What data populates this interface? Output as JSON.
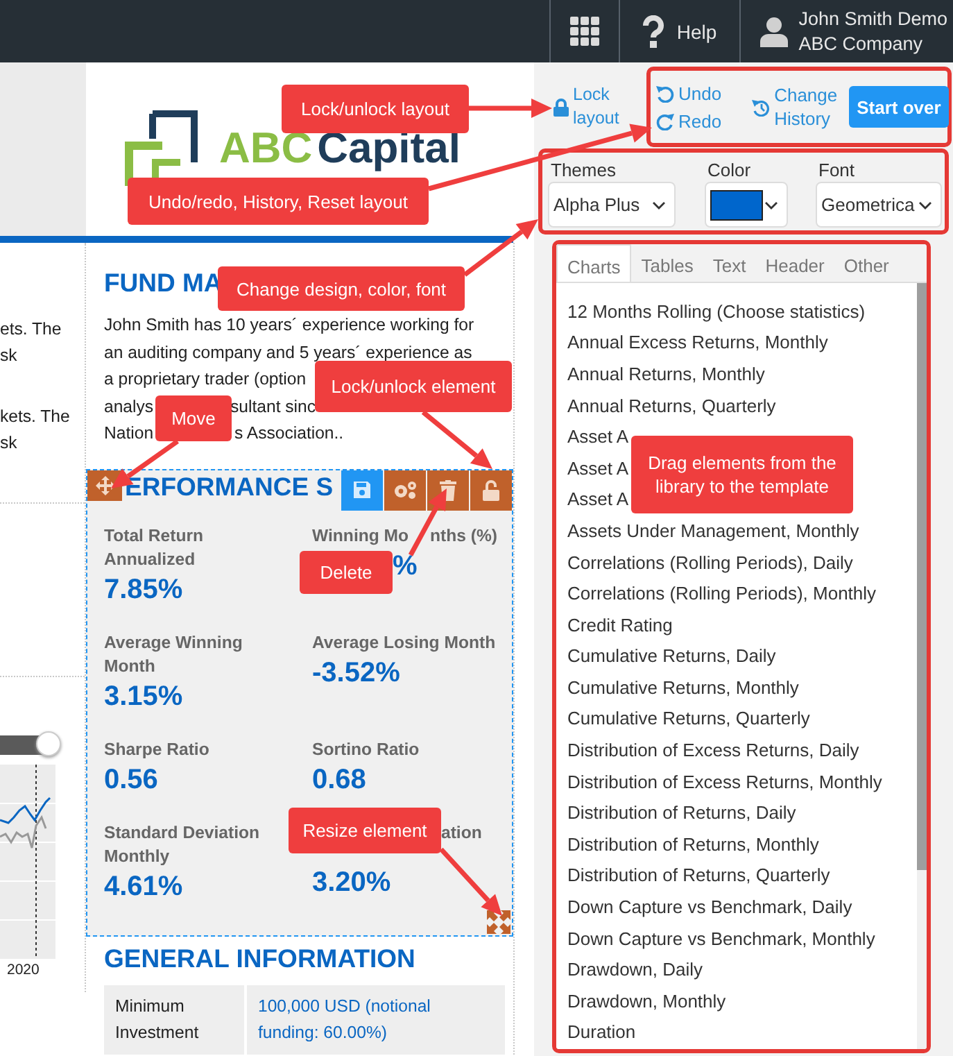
{
  "top_bar": {
    "help": "Help",
    "user": {
      "name": "John Smith Demo",
      "company": "ABC Company"
    }
  },
  "template": {
    "logo": {
      "part_1": "ABC",
      "part_2": "Capital"
    },
    "left_column": {
      "paragraphs": [
        [
          "ets. The",
          "sk"
        ],
        [
          "kets. The",
          "sk"
        ]
      ],
      "chart": {
        "x_tick": "2020"
      },
      "slider": {
        "level": 1
      }
    },
    "fund_manager": {
      "title": "FUND MA",
      "lines": [
        {
          "segments": [
            "John Smith has 10 years´ experience working for"
          ]
        },
        {
          "segments": [
            "an auditing company and 5 years´ experience as"
          ]
        },
        {
          "segments": [
            "a proprietary trader (option"
          ]
        },
        {
          "segments": [
            "analys",
            "sultant sinc"
          ]
        },
        {
          "segments": [
            "Nation",
            "s Association.."
          ]
        }
      ]
    },
    "performance": {
      "title": "ERFORMANCE S",
      "stats": [
        {
          "label": "Total Return Annualized",
          "value": "7.85%"
        },
        {
          "label": [
            "Winning Mo",
            "nths (%)"
          ],
          "value": "%"
        },
        {
          "label": "Average Winning Month",
          "value": "3.15%"
        },
        {
          "label": "Average Losing Month",
          "value": "-3.52%"
        },
        {
          "label": "Sharpe Ratio",
          "value": "0.56"
        },
        {
          "label": "Sortino Ratio",
          "value": "0.68"
        },
        {
          "label": "Standard Deviation Monthly",
          "value": "4.61%"
        },
        {
          "label": "ation",
          "value": "3.20%"
        }
      ]
    },
    "general_information": {
      "title": "GENERAL INFORMATION",
      "rows": [
        {
          "label": "Minimum Investment",
          "value": "100,000 USD (notional funding: 60.00%)"
        }
      ]
    }
  },
  "toolbar": {
    "lock_layout": "Lock layout",
    "undo": "Undo",
    "redo": "Redo",
    "change_history": "Change History",
    "start_over": "Start over"
  },
  "design": {
    "themes": {
      "label": "Themes",
      "value": "Alpha Plus"
    },
    "color": {
      "label": "Color",
      "color": "#0066cc"
    },
    "font": {
      "label": "Font",
      "value": "Geometrica"
    }
  },
  "library": {
    "tabs": [
      {
        "label": "Charts",
        "selected": true
      },
      {
        "label": "Tables",
        "selected": false
      },
      {
        "label": "Text",
        "selected": false
      },
      {
        "label": "Header",
        "selected": false
      },
      {
        "label": "Other",
        "selected": false
      }
    ],
    "items": [
      "12 Months Rolling (Choose statistics)",
      "Annual Excess Returns, Monthly",
      "Annual Returns, Monthly",
      "Annual Returns, Quarterly",
      "Asset A",
      "Asset A",
      "Asset A",
      "Assets Under Management, Monthly",
      "Correlations (Rolling Periods), Daily",
      "Correlations (Rolling Periods), Monthly",
      "Credit Rating",
      "Cumulative Returns, Daily",
      "Cumulative Returns, Monthly",
      "Cumulative Returns, Quarterly",
      "Distribution of Excess Returns, Daily",
      "Distribution of Excess Returns, Monthly",
      "Distribution of Returns, Daily",
      "Distribution of Returns, Monthly",
      "Distribution of Returns, Quarterly",
      "Down Capture vs Benchmark, Daily",
      "Down Capture vs Benchmark, Monthly",
      "Drawdown, Daily",
      "Drawdown, Monthly",
      "Duration"
    ]
  },
  "annotations": [
    {
      "text": "Lock/unlock layout"
    },
    {
      "text": "Undo/redo, History, Reset layout"
    },
    {
      "text": "Change design, color, font"
    },
    {
      "text": "Move"
    },
    {
      "text": "Lock/unlock element"
    },
    {
      "text": "Delete"
    },
    {
      "text": "Drag elements from the library to the template"
    },
    {
      "text": "Resize element"
    }
  ]
}
